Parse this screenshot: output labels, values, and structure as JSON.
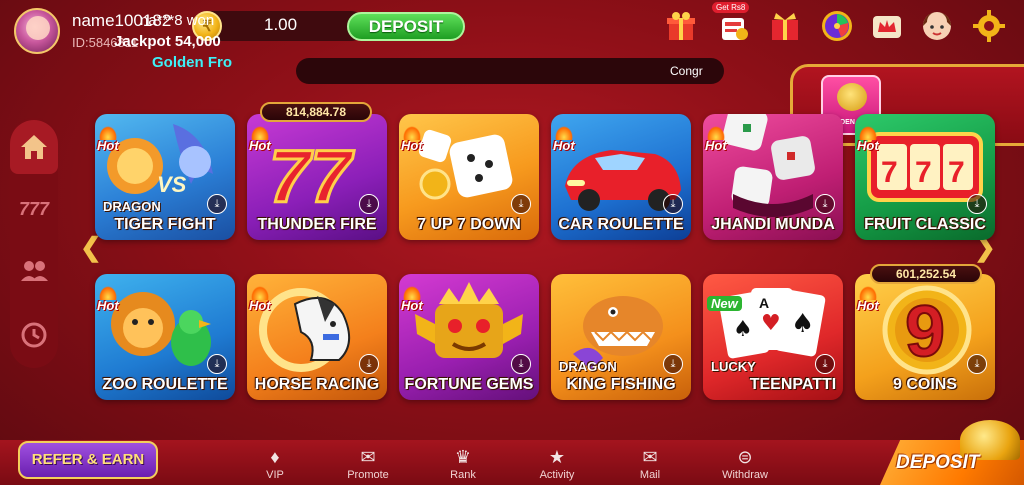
{
  "user": {
    "name": "name100182",
    "id": "ID:5846811"
  },
  "balance": {
    "amount": "1.00",
    "deposit_label": "DEPOSIT"
  },
  "top_icons": [
    {
      "name": "gift-box-icon"
    },
    {
      "name": "get-rs-icon",
      "badge": "Get Rs8"
    },
    {
      "name": "present-icon"
    },
    {
      "name": "lucky-wheel-icon"
    },
    {
      "name": "vip-crown-icon"
    },
    {
      "name": "support-agent-icon"
    },
    {
      "name": "settings-gear-icon"
    }
  ],
  "marquee": {
    "text": "Congr"
  },
  "jackpot_toast": {
    "thumb_label": "GOLDEN FROG",
    "line1": "na***8 won",
    "line2": "Jackpot 54,000",
    "line3": "Golden Fro"
  },
  "left_nav": [
    {
      "name": "home-icon",
      "active": true
    },
    {
      "name": "slots-777-icon",
      "active": false
    },
    {
      "name": "multiplayer-icon",
      "active": false
    },
    {
      "name": "history-icon",
      "active": false
    }
  ],
  "games_row1": [
    {
      "title": "TIGER  FIGHT",
      "subtitle": "DRAGON",
      "badge": "Hot",
      "jackpot": ""
    },
    {
      "title": "THUNDER FIRE",
      "subtitle": "",
      "badge": "Hot",
      "jackpot": "814,884.78"
    },
    {
      "title": "7 UP 7 DOWN",
      "subtitle": "",
      "badge": "Hot",
      "jackpot": ""
    },
    {
      "title": "CAR ROULETTE",
      "subtitle": "",
      "badge": "Hot",
      "jackpot": ""
    },
    {
      "title": "JHANDI MUNDA",
      "subtitle": "",
      "badge": "Hot",
      "jackpot": ""
    },
    {
      "title": "FRUIT CLASSIC",
      "subtitle": "",
      "badge": "Hot",
      "jackpot": ""
    }
  ],
  "games_row2": [
    {
      "title": "ZOO ROULETTE",
      "subtitle": "",
      "badge": "Hot",
      "jackpot": ""
    },
    {
      "title": "HORSE RACING",
      "subtitle": "",
      "badge": "Hot",
      "jackpot": ""
    },
    {
      "title": "FORTUNE GEMS",
      "subtitle": "",
      "badge": "Hot",
      "jackpot": ""
    },
    {
      "title": "KING FISHING",
      "subtitle": "DRAGON",
      "badge": "",
      "jackpot": ""
    },
    {
      "title": "TEENPATTI",
      "subtitle": "LUCKY",
      "badge": "New",
      "jackpot": ""
    },
    {
      "title": "9 COINS",
      "subtitle": "",
      "badge": "Hot",
      "jackpot": "601,252.54"
    }
  ],
  "bottom_nav": {
    "refer_label": "REFER & EARN",
    "items": [
      "VIP",
      "Promote",
      "Rank",
      "Activity",
      "Mail",
      "Withdraw"
    ],
    "deposit_label": "DEPOSIT"
  },
  "colors": {
    "background": "#9a121b",
    "accent_gold": "#f2c14a",
    "deposit_green": "#2bb52f",
    "jackpot_cyan": "#3ef0f7"
  }
}
